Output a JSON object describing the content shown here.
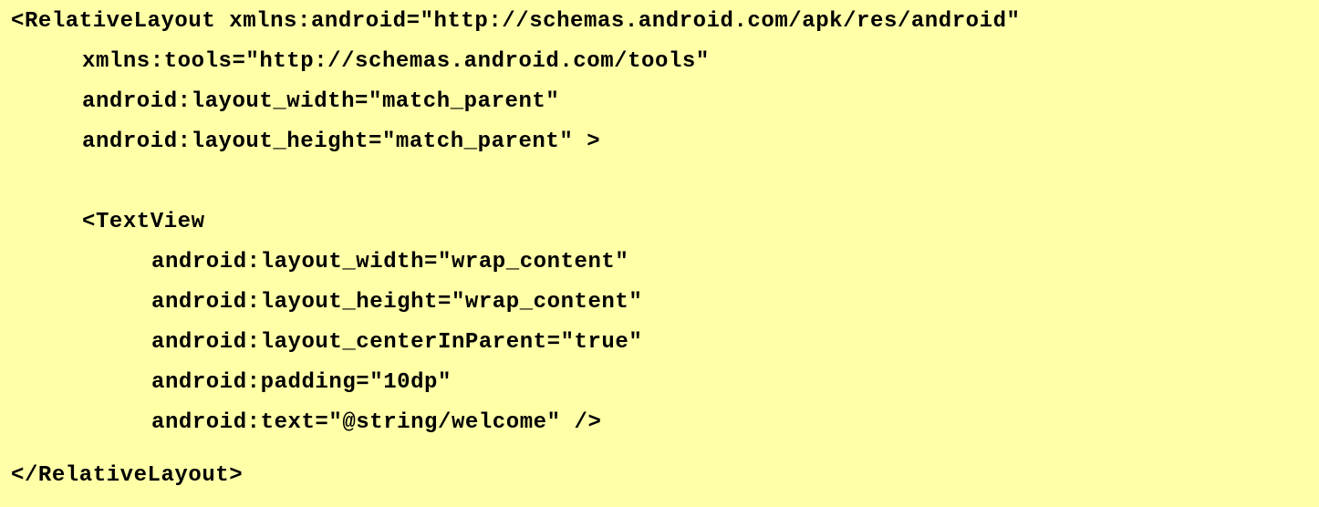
{
  "document": {
    "background_color": "#ffffa8",
    "text_color": "#000000",
    "lines": [
      "<RelativeLayout xmlns:android=\"http://schemas.android.com/apk/res/android\"",
      "xmlns:tools=\"http://schemas.android.com/tools\"",
      "android:layout_width=\"match_parent\"",
      "android:layout_height=\"match_parent\" >",
      "<TextView",
      "android:layout_width=\"wrap_content\"",
      "android:layout_height=\"wrap_content\"",
      "android:layout_centerInParent=\"true\"",
      "android:padding=\"10dp\"",
      "android:text=\"@string/welcome\" />",
      "</RelativeLayout>"
    ]
  }
}
